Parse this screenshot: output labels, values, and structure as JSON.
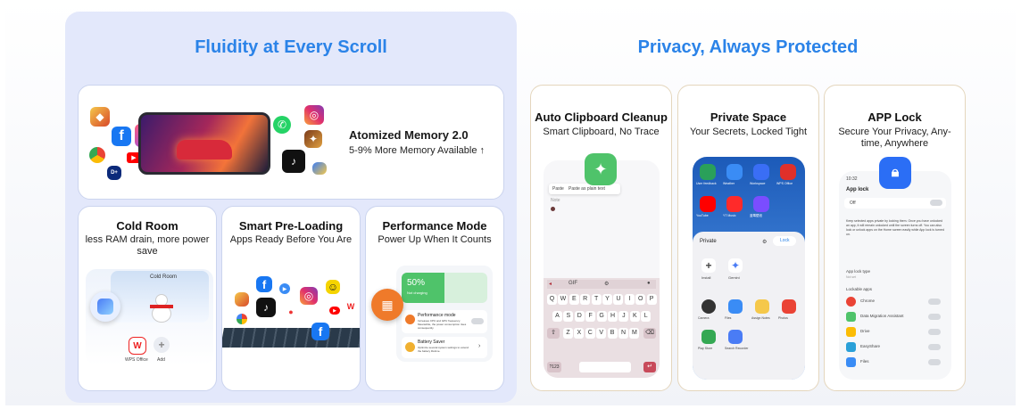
{
  "sections": {
    "left_title": "Fluidity at Every Scroll",
    "right_title": "Privacy, Always Protected"
  },
  "memory": {
    "title": "Atomized Memory 2.0",
    "subtitle": "5-9% More Memory Available ↑"
  },
  "cold_room": {
    "title": "Cold Room",
    "subtitle": "less RAM drain, more power save",
    "screen_label": "Cold Room",
    "app1": "WPS Office",
    "app2": "Add"
  },
  "preloading": {
    "title": "Smart Pre-Loading",
    "subtitle": "Apps Ready Before You Are"
  },
  "performance": {
    "title": "Performance Mode",
    "subtitle": "Power Up When It Counts",
    "battery_percent": "50%",
    "battery_status": "Not charging",
    "battery_level": 0.5,
    "mode_label": "Performance mode",
    "mode_desc": "Increases CPU and GPU frequency. Meanwhile, the power consumption rises consequently.",
    "saver_label": "Battery Saver",
    "saver_desc": "Optimize several system settings to extend the battery lifetime."
  },
  "clipboard": {
    "title": "Auto Clipboard Cleanup",
    "subtitle": "Smart Clipboard, No Trace",
    "paste": "Paste",
    "paste_plain": "Paste as plain text",
    "note": "Note",
    "rows": [
      [
        "Q",
        "W",
        "E",
        "R",
        "T",
        "Y",
        "U",
        "I",
        "O",
        "P"
      ],
      [
        "A",
        "S",
        "D",
        "F",
        "G",
        "H",
        "J",
        "K",
        "L"
      ],
      [
        "Z",
        "X",
        "C",
        "V",
        "B",
        "N",
        "M"
      ]
    ],
    "num_key": "?123"
  },
  "private_space": {
    "title": "Private Space",
    "subtitle": "Your Secrets, Locked Tight",
    "top_apps": [
      "User feedback",
      "Weather",
      "Workspace",
      "WPS Office",
      "YouTube",
      "YT Music",
      "蓝莓壁纸"
    ],
    "label": "Private",
    "lock": "Lock",
    "install": "Install",
    "gemini": "Gemini",
    "bottom_apps": [
      "Camera",
      "Files",
      "Assign Notes",
      "Photos",
      "Play Store",
      "Search Recorder"
    ]
  },
  "app_lock": {
    "title": "APP Lock",
    "subtitle": "Secure Your Privacy, Any-time, Anywhere",
    "time": "10:32",
    "header": "App lock",
    "off": "Off",
    "desc": "Keep selected apps private by locking them. Once you have unlocked an app, it will remain unlocked until the screen turns off. You can also lock or unlock apps on the Home screen easily while App lock is turned on.",
    "lock_type": "App lock type",
    "lock_type_value": "Not set",
    "lockable": "Lockable apps",
    "apps": [
      "Chrome",
      "Data Migration Assistant",
      "Drive",
      "EasyShare",
      "Files"
    ]
  },
  "colors": {
    "accent": "#2b83e8",
    "panel": "#e3e8fb",
    "green": "#4fc36a",
    "orange": "#ef7a2a"
  }
}
